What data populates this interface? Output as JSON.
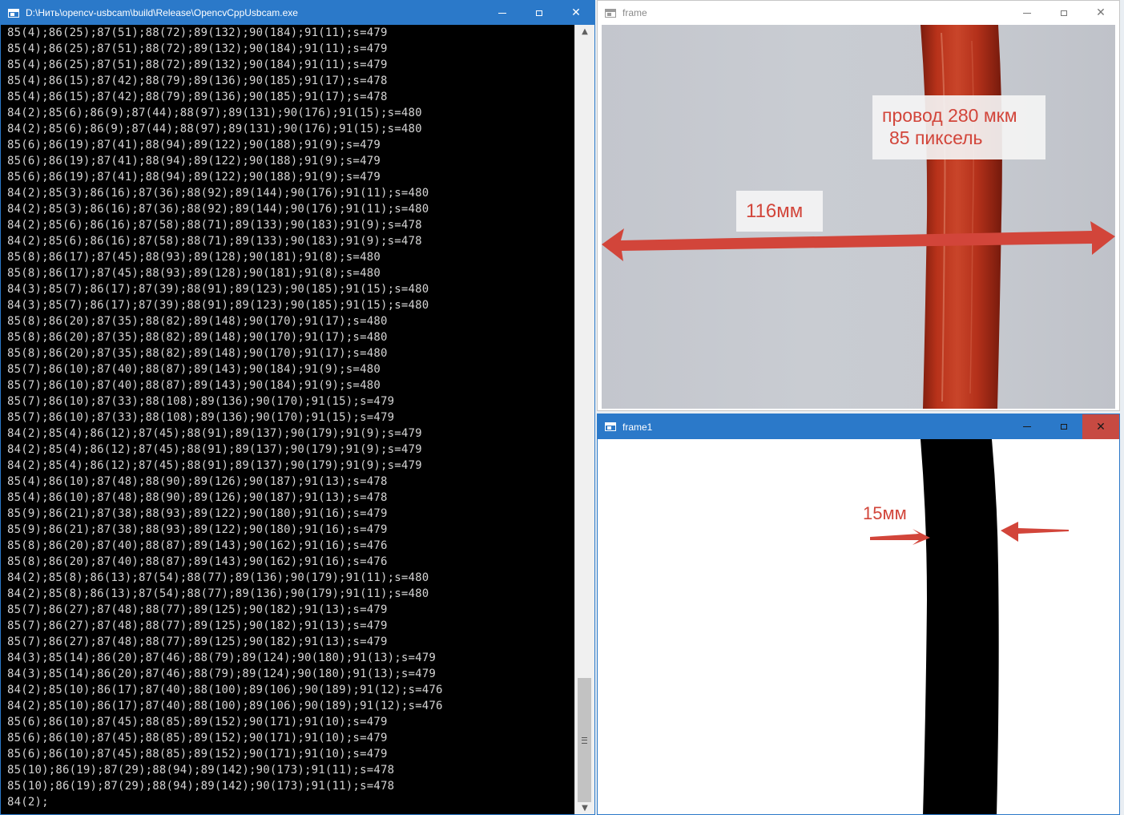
{
  "console": {
    "title": "D:\\Нить\\opencv-usbcam\\build\\Release\\OpencvCppUsbcam.exe",
    "lines": [
      "85(4);86(25);87(51);88(72);89(132);90(184);91(11);s=479",
      "85(4);86(25);87(51);88(72);89(132);90(184);91(11);s=479",
      "85(4);86(25);87(51);88(72);89(132);90(184);91(11);s=479",
      "85(4);86(15);87(42);88(79);89(136);90(185);91(17);s=478",
      "85(4);86(15);87(42);88(79);89(136);90(185);91(17);s=478",
      "84(2);85(6);86(9);87(44);88(97);89(131);90(176);91(15);s=480",
      "84(2);85(6);86(9);87(44);88(97);89(131);90(176);91(15);s=480",
      "85(6);86(19);87(41);88(94);89(122);90(188);91(9);s=479",
      "85(6);86(19);87(41);88(94);89(122);90(188);91(9);s=479",
      "85(6);86(19);87(41);88(94);89(122);90(188);91(9);s=479",
      "84(2);85(3);86(16);87(36);88(92);89(144);90(176);91(11);s=480",
      "84(2);85(3);86(16);87(36);88(92);89(144);90(176);91(11);s=480",
      "84(2);85(6);86(16);87(58);88(71);89(133);90(183);91(9);s=478",
      "84(2);85(6);86(16);87(58);88(71);89(133);90(183);91(9);s=478",
      "85(8);86(17);87(45);88(93);89(128);90(181);91(8);s=480",
      "85(8);86(17);87(45);88(93);89(128);90(181);91(8);s=480",
      "84(3);85(7);86(17);87(39);88(91);89(123);90(185);91(15);s=480",
      "84(3);85(7);86(17);87(39);88(91);89(123);90(185);91(15);s=480",
      "85(8);86(20);87(35);88(82);89(148);90(170);91(17);s=480",
      "85(8);86(20);87(35);88(82);89(148);90(170);91(17);s=480",
      "85(8);86(20);87(35);88(82);89(148);90(170);91(17);s=480",
      "85(7);86(10);87(40);88(87);89(143);90(184);91(9);s=480",
      "85(7);86(10);87(40);88(87);89(143);90(184);91(9);s=480",
      "85(7);86(10);87(33);88(108);89(136);90(170);91(15);s=479",
      "85(7);86(10);87(33);88(108);89(136);90(170);91(15);s=479",
      "84(2);85(4);86(12);87(45);88(91);89(137);90(179);91(9);s=479",
      "84(2);85(4);86(12);87(45);88(91);89(137);90(179);91(9);s=479",
      "84(2);85(4);86(12);87(45);88(91);89(137);90(179);91(9);s=479",
      "85(4);86(10);87(48);88(90);89(126);90(187);91(13);s=478",
      "85(4);86(10);87(48);88(90);89(126);90(187);91(13);s=478",
      "85(9);86(21);87(38);88(93);89(122);90(180);91(16);s=479",
      "85(9);86(21);87(38);88(93);89(122);90(180);91(16);s=479",
      "85(8);86(20);87(40);88(87);89(143);90(162);91(16);s=476",
      "85(8);86(20);87(40);88(87);89(143);90(162);91(16);s=476",
      "84(2);85(8);86(13);87(54);88(77);89(136);90(179);91(11);s=480",
      "84(2);85(8);86(13);87(54);88(77);89(136);90(179);91(11);s=480",
      "85(7);86(27);87(48);88(77);89(125);90(182);91(13);s=479",
      "85(7);86(27);87(48);88(77);89(125);90(182);91(13);s=479",
      "85(7);86(27);87(48);88(77);89(125);90(182);91(13);s=479",
      "84(3);85(14);86(20);87(46);88(79);89(124);90(180);91(13);s=479",
      "84(3);85(14);86(20);87(46);88(79);89(124);90(180);91(13);s=479",
      "84(2);85(10);86(17);87(40);88(100);89(106);90(189);91(12);s=476",
      "84(2);85(10);86(17);87(40);88(100);89(106);90(189);91(12);s=476",
      "85(6);86(10);87(45);88(85);89(152);90(171);91(10);s=479",
      "85(6);86(10);87(45);88(85);89(152);90(171);91(10);s=479",
      "85(6);86(10);87(45);88(85);89(152);90(171);91(10);s=479",
      "85(10);86(19);87(29);88(94);89(142);90(173);91(11);s=478",
      "85(10);86(19);87(29);88(94);89(142);90(173);91(11);s=478",
      "84(2);"
    ]
  },
  "frame": {
    "title": "frame",
    "annotation_wire": "провод 280 мкм",
    "annotation_pixels": "85 пиксель",
    "annotation_width": "116мм"
  },
  "frame1": {
    "title": "frame1",
    "annotation_width": "15мм"
  },
  "colors": {
    "accent": "#2b79c9",
    "annotation": "#d2453a",
    "close_hover": "#c74a42",
    "wire": "#b8321a"
  },
  "icons": {
    "minimize": "minimize-icon",
    "maximize": "maximize-icon",
    "close": "close-icon",
    "app": "app-window-icon"
  }
}
